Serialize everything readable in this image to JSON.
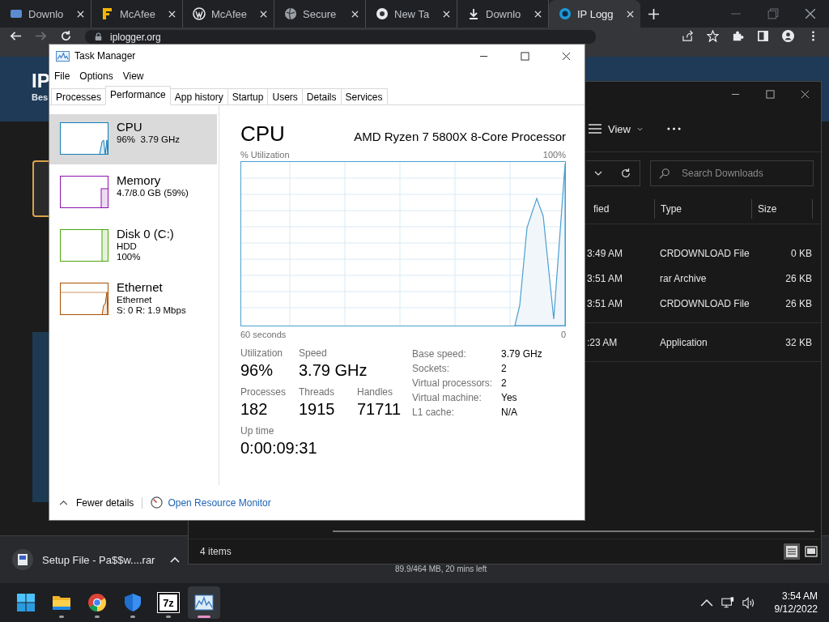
{
  "browser": {
    "tabs": [
      {
        "kind": "site",
        "label": "Downlo",
        "selected": false
      },
      {
        "kind": "brand",
        "label": "McAfee",
        "selected": false
      },
      {
        "kind": "blog",
        "label": "McAfee",
        "selected": false
      },
      {
        "kind": "globe",
        "label": "Secure",
        "selected": false
      },
      {
        "kind": "newtab",
        "label": "New Ta",
        "selected": false
      },
      {
        "kind": "download",
        "label": "Downlo",
        "selected": false
      },
      {
        "kind": "logger",
        "label": "IP Logg",
        "selected": true
      }
    ],
    "address": "iplogger.org",
    "page": {
      "heading": "IP",
      "subheading": "Bes"
    }
  },
  "explorer": {
    "view": "View",
    "search": {
      "placeholder": "Search Downloads"
    },
    "columns": [
      "fied",
      "Type",
      "Size"
    ],
    "groups": [
      [
        {
          "time": "3:49 AM",
          "type": "CRDOWNLOAD File",
          "size": "0 KB"
        },
        {
          "time": "3:51 AM",
          "type": "rar Archive",
          "size": "26 KB"
        },
        {
          "time": "3:51 AM",
          "type": "CRDOWNLOAD File",
          "size": "26 KB"
        }
      ],
      [
        {
          "time": ":23 AM",
          "type": "Application",
          "size": "32 KB"
        }
      ]
    ],
    "status": "4 items"
  },
  "download_shelf": {
    "file": "Setup File - Pa$$w....rar",
    "progress": "89.9/464 MB, 20 mins left"
  },
  "task_manager": {
    "title": "Task Manager",
    "menu": [
      "File",
      "Options",
      "View"
    ],
    "tabs": [
      {
        "label": "Processes",
        "selected": false
      },
      {
        "label": "Performance",
        "selected": true
      },
      {
        "label": "App history",
        "selected": false
      },
      {
        "label": "Startup",
        "selected": false
      },
      {
        "label": "Users",
        "selected": false
      },
      {
        "label": "Details",
        "selected": false
      },
      {
        "label": "Services",
        "selected": false
      }
    ],
    "resources": [
      {
        "kind": "cpu",
        "name": "CPU",
        "lines": [
          "96%  3.79 GHz"
        ],
        "color": "#117dbb",
        "selected": true
      },
      {
        "kind": "memory",
        "name": "Memory",
        "lines": [
          "4.7/8.0 GB (59%)"
        ],
        "color": "#8b12ae",
        "selected": false
      },
      {
        "kind": "disk",
        "name": "Disk 0 (C:)",
        "lines": [
          "HDD",
          "100%"
        ],
        "color": "#4da60c",
        "selected": false
      },
      {
        "kind": "network",
        "name": "Ethernet",
        "lines": [
          "Ethernet",
          "S: 0 R: 1.9 Mbps"
        ],
        "color": "#a74f01",
        "selected": false
      }
    ],
    "detail": {
      "title": "CPU",
      "processor": "AMD Ryzen 7 5800X 8-Core Processor",
      "graph_label": "% Utilization",
      "graph_max": "100%",
      "graph_span": "60 seconds",
      "graph_min": "0",
      "stats": [
        [
          {
            "label": "Utilization",
            "value": "96%"
          },
          {
            "label": "Speed",
            "value": "3.79 GHz"
          }
        ],
        [
          {
            "label": "Processes",
            "value": "182"
          },
          {
            "label": "Threads",
            "value": "1915"
          },
          {
            "label": "Handles",
            "value": "71711"
          }
        ],
        [
          {
            "label": "Up time",
            "value": "0:00:09:31"
          }
        ]
      ],
      "specs": [
        {
          "label": "Base speed:",
          "value": "3.79 GHz"
        },
        {
          "label": "Sockets:",
          "value": "2"
        },
        {
          "label": "Virtual processors:",
          "value": "2"
        },
        {
          "label": "Virtual machine:",
          "value": "Yes"
        },
        {
          "label": "L1 cache:",
          "value": "N/A"
        }
      ]
    },
    "footer": {
      "fewer": "Fewer details",
      "monitor": "Open Resource Monitor"
    }
  },
  "taskbar": {
    "apps": [
      {
        "kind": "start",
        "running": false,
        "selected": false
      },
      {
        "kind": "files",
        "running": true,
        "selected": false
      },
      {
        "kind": "chrome",
        "running": true,
        "selected": false
      },
      {
        "kind": "shield",
        "running": true,
        "selected": false
      },
      {
        "kind": "archiver",
        "label": "7z",
        "running": true,
        "selected": false
      },
      {
        "kind": "monitor",
        "running": true,
        "selected": true
      }
    ],
    "time": "3:54 AM",
    "date": "9/12/2022"
  }
}
